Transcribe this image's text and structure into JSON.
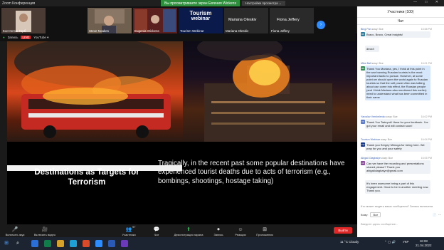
{
  "window": {
    "title": "Zoom Конференция",
    "banner": "Вы просматриваете экран Евгения Wickens",
    "view_options": "Настройки просмотра ⌄",
    "controls": "—  □  ✕"
  },
  "gallery": {
    "tiles": [
      {
        "label": "Костянтин Горб"
      },
      {
        "label": "Steve Noakes"
      },
      {
        "label": "Eugenia Wickens"
      },
      {
        "label": "Tourism Webinar",
        "logo_line1": "Tourism",
        "logo_line2": "webinar"
      },
      {
        "label": "Mariana Oleskiv",
        "name_large": "Mariana Oleskiv"
      },
      {
        "label": "Fiona Jeffery",
        "name_large": "Fiona Jeffery"
      }
    ],
    "next_icon": "›"
  },
  "share_bar": {
    "recording": "Запись",
    "live": "LIVE",
    "youtube": "YouTube ▾"
  },
  "slide": {
    "title": "Destinations as Targets for Terrorism",
    "body": "Tragically, in the recent past some popular destinations have experienced tourist deaths due to acts of terrorism (e.g., bombings, shootings, hostage taking)"
  },
  "chat_panel": {
    "participants_header": "Участники (100)",
    "chat_header": "Чат",
    "messages": [
      {
        "sender": "Bing Pan",
        "to": "кому: Все",
        "time": "15:58 PM",
        "avatar": "BP",
        "text": "Bravo, Bravo, Great insights!",
        "highlight": false
      },
      {
        "sender": "",
        "to": "",
        "time": "",
        "avatar": "",
        "text": "decid!",
        "highlight": false
      },
      {
        "sender": "Mike Ball",
        "to": "кому: Все",
        "time": "16:01 PM",
        "avatar": "MB",
        "text": "Thank You Mariana, yes, I think at this point in the war banning Russian tourists is the most important tactic to pursue. However, at some point we should open the world again to Russian tourists so that the soft power Alec was talking about can come into effect, the Russian people (and I think Mariana also mentioned this earlier) need to understand what has been committed in their name",
        "highlight": true
      },
      {
        "sender": "Yaroslav Vershelenko",
        "to": "кому: Все",
        "time": "16:02 PM",
        "avatar": "YV",
        "text": "Thank You Tadeyuk! Hava for your feedback. I've got your email and will contact soon!",
        "highlight": false
      },
      {
        "sender": "Tourism Webinar",
        "to": "кому: Все",
        "time": "16:04 PM",
        "avatar": "TW",
        "text": "Thank you Sergey Mimoga for being here. We pray for you and your safety",
        "highlight": false
      },
      {
        "sender": "Abigail Olagbaiye",
        "to": "кому: Все",
        "time": "16:05 PM",
        "avatar": "AO",
        "text": "Can we have the recording and presentations shared please? Thank you abigailolagbaiye@gmail.com",
        "highlight": false
      },
      {
        "sender": "",
        "to": "",
        "time": "",
        "avatar": "",
        "text": "It's been awesome being a part of this engagement. Have to be in another meeting now. Thank you.",
        "highlight": false
      }
    ],
    "input_hint": "Кто может видеть ваши сообщения? Запись включена",
    "to_label": "Кому:",
    "to_value": "Все",
    "type_placeholder": "Введите здесь сообщение..."
  },
  "toolbar": {
    "items": [
      {
        "icon": "🎤",
        "label": "Включить звук"
      },
      {
        "icon": "🎥",
        "label": "Включить видео"
      },
      {
        "icon": "👥",
        "label": "Участники",
        "badge": "97"
      },
      {
        "icon": "💬",
        "label": "Чат"
      },
      {
        "icon": "⬆",
        "label": "Демонстрация экрана"
      },
      {
        "icon": "⏺",
        "label": "Запись"
      },
      {
        "icon": "☺",
        "label": "Реакции"
      },
      {
        "icon": "⊞",
        "label": "Приложения"
      }
    ],
    "leave_label": "Выйти"
  },
  "taskbar": {
    "weather": "11 °C  Cloudy",
    "lang": "УКР",
    "time": "16:08",
    "date": "21.04.2022",
    "colors": {
      "bg": "#1c2431"
    }
  }
}
